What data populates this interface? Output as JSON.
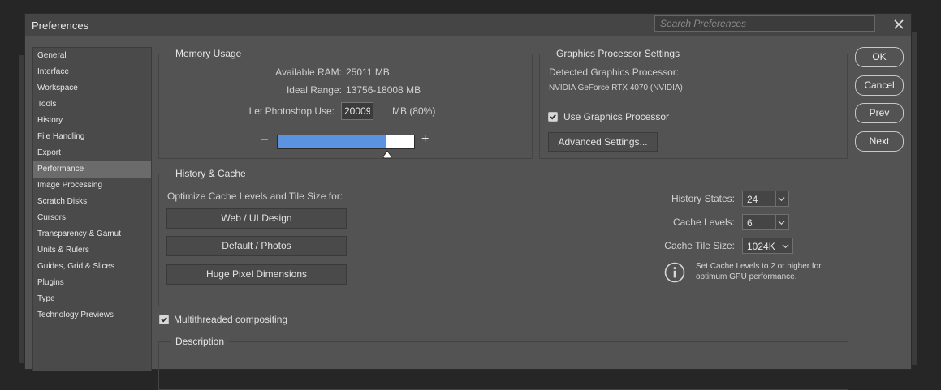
{
  "dialog": {
    "title": "Preferences",
    "search_placeholder": "Search Preferences"
  },
  "sidebar": {
    "items": [
      {
        "label": "General"
      },
      {
        "label": "Interface"
      },
      {
        "label": "Workspace"
      },
      {
        "label": "Tools"
      },
      {
        "label": "History"
      },
      {
        "label": "File Handling"
      },
      {
        "label": "Export"
      },
      {
        "label": "Performance",
        "selected": true
      },
      {
        "label": "Image Processing"
      },
      {
        "label": "Scratch Disks"
      },
      {
        "label": "Cursors"
      },
      {
        "label": "Transparency & Gamut"
      },
      {
        "label": "Units & Rulers"
      },
      {
        "label": "Guides, Grid & Slices"
      },
      {
        "label": "Plugins"
      },
      {
        "label": "Type"
      },
      {
        "label": "Technology Previews"
      }
    ]
  },
  "memory": {
    "title": "Memory Usage",
    "available_label": "Available RAM:",
    "available_value": "25011 MB",
    "ideal_label": "Ideal Range:",
    "ideal_value": "13756-18008 MB",
    "use_label": "Let Photoshop Use:",
    "use_value": "20009",
    "use_suffix": "MB (80%)",
    "minus": "–",
    "plus": "+",
    "slider_fraction": 0.8
  },
  "gpu": {
    "title": "Graphics Processor Settings",
    "detected_label": "Detected Graphics Processor:",
    "detected_value": "NVIDIA GeForce RTX 4070 (NVIDIA)",
    "use_gpu_label": "Use Graphics Processor",
    "use_gpu_checked": true,
    "advanced_button": "Advanced Settings..."
  },
  "history_cache": {
    "title": "History & Cache",
    "optimize_label": "Optimize Cache Levels and Tile Size for:",
    "presets": [
      "Web / UI Design",
      "Default / Photos",
      "Huge Pixel Dimensions"
    ],
    "history_states_label": "History States:",
    "history_states_value": "24",
    "cache_levels_label": "Cache Levels:",
    "cache_levels_value": "6",
    "tile_size_label": "Cache Tile Size:",
    "tile_size_value": "1024K",
    "info_text_1": "Set Cache Levels to 2 or higher for",
    "info_text_2": "optimum GPU performance."
  },
  "multithreaded": {
    "label": "Multithreaded compositing",
    "checked": true
  },
  "description": {
    "title": "Description"
  },
  "buttons": {
    "ok": "OK",
    "cancel": "Cancel",
    "prev": "Prev",
    "next": "Next"
  },
  "colors": {
    "dialog_bg": "#535353",
    "selection": "#6b6b6b",
    "slider_fill": "#5b93e0"
  }
}
